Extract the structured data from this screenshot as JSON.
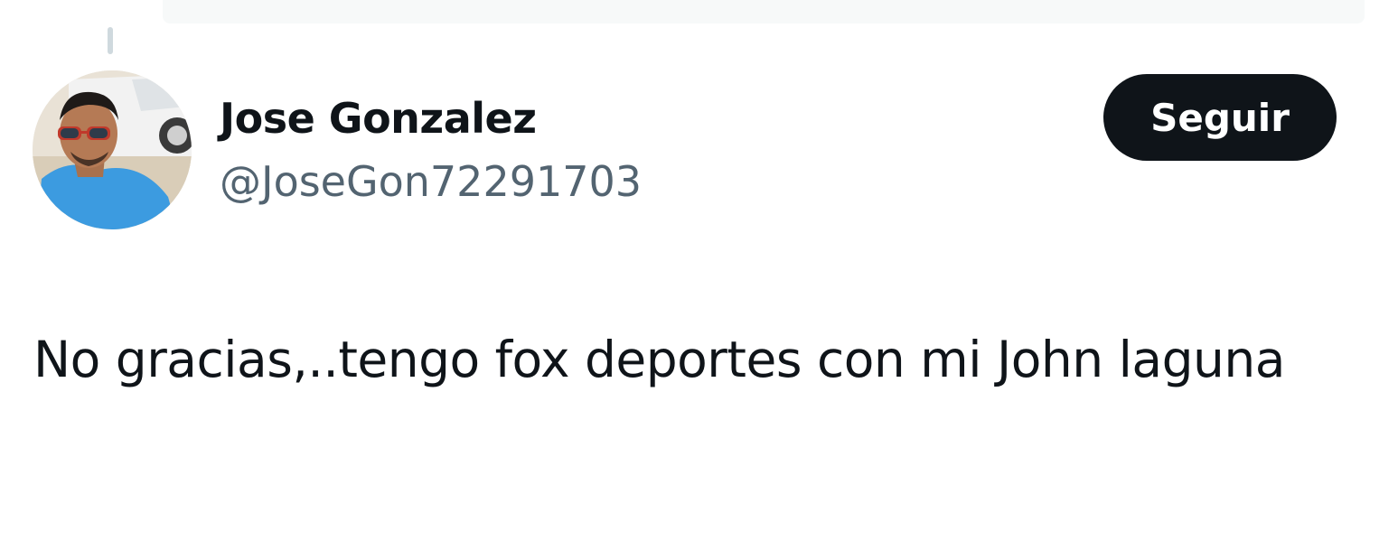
{
  "tweet": {
    "author": {
      "display_name": "Jose Gonzalez",
      "handle": "@JoseGon72291703",
      "avatar_icon": "user-avatar-photo"
    },
    "follow_label": "Seguir",
    "text": "No gracias,..tengo fox deportes con mi John laguna"
  },
  "colors": {
    "text_primary": "#0f1419",
    "text_secondary": "#536471",
    "button_bg": "#0f1419",
    "button_text": "#ffffff",
    "thread_line": "#cfd9de"
  }
}
